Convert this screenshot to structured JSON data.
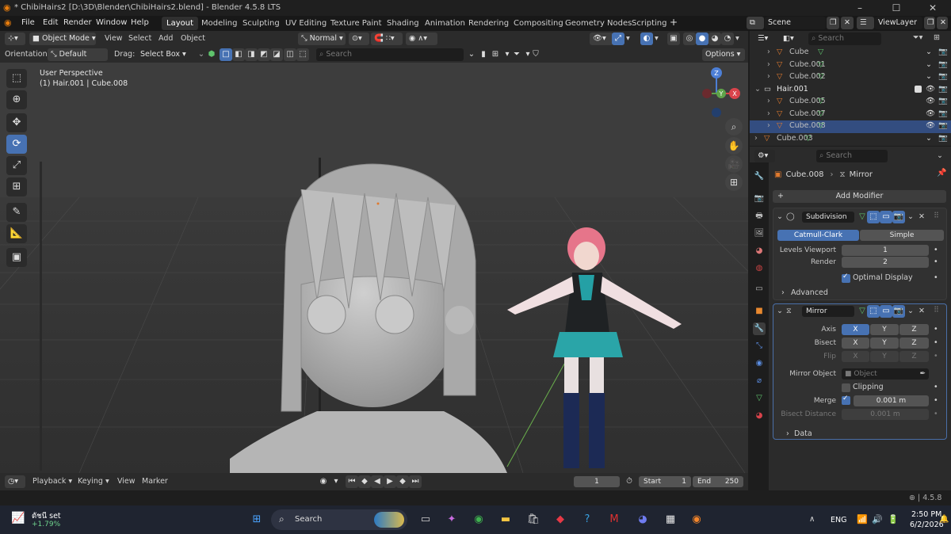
{
  "window": {
    "title": "* ChibiHairs2 [D:\\3D\\Blender\\ChibiHairs2.blend] - Blender 4.5.8 LTS"
  },
  "menus": [
    "File",
    "Edit",
    "Render",
    "Window",
    "Help"
  ],
  "workspaces": [
    "Layout",
    "Modeling",
    "Sculpting",
    "UV Editing",
    "Texture Paint",
    "Shading",
    "Animation",
    "Rendering",
    "Compositing",
    "Geometry Nodes",
    "Scripting"
  ],
  "scene": {
    "name": "Scene",
    "view_layer": "ViewLayer"
  },
  "viewport": {
    "mode": "Object Mode",
    "menu": [
      "View",
      "Select",
      "Add",
      "Object"
    ],
    "transform_orientation": "Normal",
    "orientation_label": "Orientation:",
    "orientation_value": "Default",
    "drag_label": "Drag:",
    "drag_value": "Select Box",
    "search_placeholder": "Search",
    "options_label": "Options",
    "perspective": "User Perspective",
    "active_info": "(1) Hair.001 | Cube.008",
    "gizmo": {
      "z": "Z",
      "x": "X",
      "y": "Y"
    }
  },
  "timeline": {
    "menus": [
      "Playback",
      "Keying",
      "View",
      "Marker"
    ],
    "current_frame": "1",
    "start_label": "Start",
    "start": "1",
    "end_label": "End",
    "end": "250"
  },
  "status": {
    "version": "4.5.8"
  },
  "outliner": {
    "search_placeholder": "Search",
    "rows": [
      {
        "name": "Cube",
        "indent": 2
      },
      {
        "name": "Cube.001",
        "indent": 2
      },
      {
        "name": "Cube.002",
        "indent": 2
      },
      {
        "name": "Hair.001",
        "indent": 1
      },
      {
        "name": "Cube.005",
        "indent": 2
      },
      {
        "name": "Cube.007",
        "indent": 2
      },
      {
        "name": "Cube.008",
        "indent": 2
      },
      {
        "name": "Cube.003",
        "indent": 1
      }
    ]
  },
  "properties": {
    "search_placeholder": "Search",
    "object": "Cube.008",
    "modifier_crumb": "Mirror",
    "add_modifier": "Add Modifier",
    "subdivision": {
      "name": "Subdivision",
      "tab_catmull": "Catmull-Clark",
      "tab_simple": "Simple",
      "levels_viewport_label": "Levels Viewport",
      "levels_viewport": "1",
      "render_label": "Render",
      "render": "2",
      "optimal_display": "Optimal Display",
      "advanced": "Advanced"
    },
    "mirror": {
      "name": "Mirror",
      "axis_label": "Axis",
      "bisect_label": "Bisect",
      "flip_label": "Flip",
      "x": "X",
      "y": "Y",
      "z": "Z",
      "mirror_object_label": "Mirror Object",
      "mirror_object_placeholder": "Object",
      "clipping": "Clipping",
      "merge_label": "Merge",
      "merge": "0.001 m",
      "bisect_distance_label": "Bisect Distance",
      "bisect_distance": "0.001 m",
      "data": "Data"
    }
  },
  "taskbar": {
    "weather_temp": "ดัชนี set",
    "weather_change": "+1.79%",
    "search": "Search",
    "lang": "ENG",
    "time": "2:50 PM",
    "date": "6/2/2026"
  },
  "colors": {
    "accent": "#4772b3",
    "mesh_orange": "#e07a2e",
    "mesh_green": "#5fc36d"
  }
}
